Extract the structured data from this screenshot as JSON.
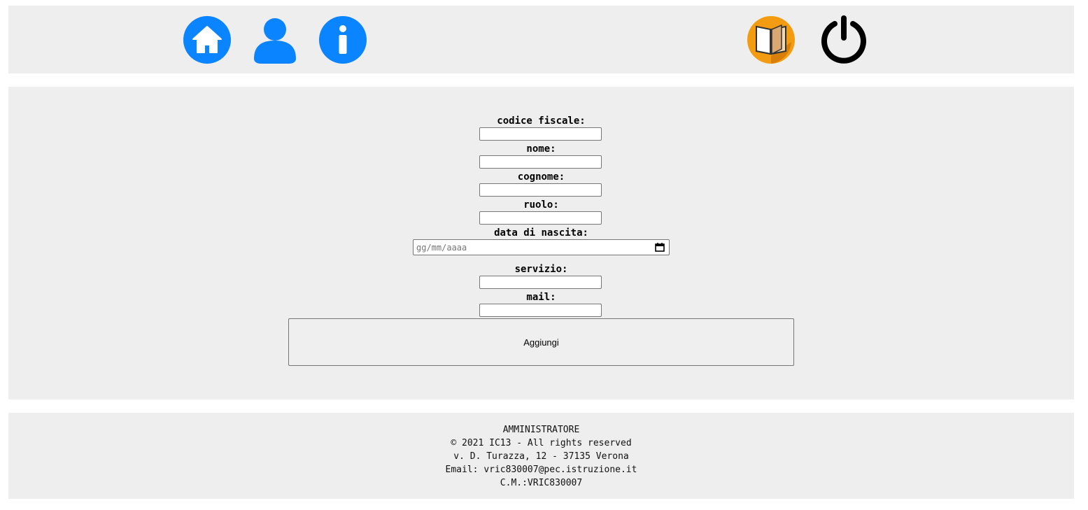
{
  "colors": {
    "panel_bg": "#eeeeee",
    "nav_blue": "#0a84ff",
    "book_orange": "#f39c12",
    "power_black": "#000000"
  },
  "header": {
    "icons": [
      "home-icon",
      "user-icon",
      "info-icon",
      "book-icon",
      "power-icon"
    ]
  },
  "form": {
    "fields": [
      {
        "label": "codice fiscale:",
        "value": ""
      },
      {
        "label": "nome:",
        "value": ""
      },
      {
        "label": "cognome:",
        "value": ""
      },
      {
        "label": "ruolo:",
        "value": ""
      },
      {
        "label": "data di nascita:",
        "placeholder": "gg/mm/aaaa"
      },
      {
        "label": "servizio:",
        "value": ""
      },
      {
        "label": "mail:",
        "value": ""
      }
    ],
    "submit_label": "Aggiungi"
  },
  "footer": {
    "role": "AMMINISTRATORE",
    "copyright": "© 2021 IC13 - All rights reserved",
    "address": "v. D. Turazza, 12 - 37135 Verona",
    "email": "Email: vric830007@pec.istruzione.it",
    "code": "C.M.:VRIC830007"
  }
}
